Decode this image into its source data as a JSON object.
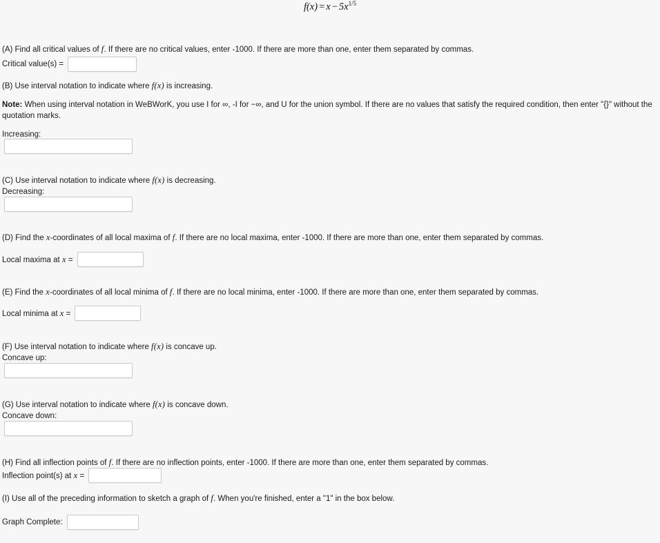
{
  "problem": {
    "formula": {
      "lhs": "f(x)",
      "equals": "=",
      "term1": "x",
      "minus": "−",
      "coefficient": "5",
      "variable": "x",
      "exponent": "1/5",
      "plain_text": "f(x) = x − 5x^(1/5)"
    }
  },
  "sections": {
    "a": {
      "prompt": "(A) Find all critical values of f. If there are no critical values, enter -1000. If there are more than one, enter them separated by commas.",
      "prompt_pre": "(A) Find all critical values of ",
      "prompt_math": "f",
      "prompt_post": ". If there are no critical values, enter -1000. If there are more than one, enter them separated by commas.",
      "field_label": "Critical value(s) =",
      "field_value": "",
      "field_placeholder": ""
    },
    "b": {
      "prompt_pre": "(B) Use interval notation to indicate where ",
      "prompt_math": "f(x)",
      "prompt_post": " is increasing.",
      "note_label": "Note:",
      "note_text_1": " When using interval notation in WeBWorK, you use I for ",
      "note_inf": "∞",
      "note_text_2": ", -I for ",
      "note_neg_inf": "−∞",
      "note_text_3": ", and U for the union symbol. If there are no values that satisfy the required condition, then enter \"{}\" without the quotation marks.",
      "field_label": "Increasing:",
      "field_value": "",
      "field_placeholder": ""
    },
    "c": {
      "prompt_pre": "(C) Use interval notation to indicate where ",
      "prompt_math": "f(x)",
      "prompt_post": " is decreasing.",
      "field_label": "Decreasing:",
      "field_value": "",
      "field_placeholder": ""
    },
    "d": {
      "prompt_pre": "(D) Find the ",
      "prompt_math": "x",
      "prompt_post": "-coordinates of all local maxima of ",
      "prompt_math2": "f",
      "prompt_post2": ". If there are no local maxima, enter -1000. If there are more than one, enter them separated by commas.",
      "field_label_pre": "Local maxima at ",
      "field_label_math": "x",
      "field_label_post": " =",
      "field_value": "",
      "field_placeholder": ""
    },
    "e": {
      "prompt_pre": "(E) Find the ",
      "prompt_math": "x",
      "prompt_post": "-coordinates of all local minima of ",
      "prompt_math2": "f",
      "prompt_post2": ". If there are no local minima, enter -1000. If there are more than one, enter them separated by commas.",
      "field_label_pre": "Local minima at ",
      "field_label_math": "x",
      "field_label_post": " =",
      "field_value": "",
      "field_placeholder": ""
    },
    "f": {
      "prompt_pre": "(F) Use interval notation to indicate where ",
      "prompt_math": "f(x)",
      "prompt_post": " is concave up.",
      "field_label": "Concave up:",
      "field_value": "",
      "field_placeholder": ""
    },
    "g": {
      "prompt_pre": "(G) Use interval notation to indicate where ",
      "prompt_math": "f(x)",
      "prompt_post": " is concave down.",
      "field_label": "Concave down:",
      "field_value": "",
      "field_placeholder": ""
    },
    "h": {
      "prompt_pre": "(H) Find all inflection points of ",
      "prompt_math": "f",
      "prompt_post": ". If there are no inflection points, enter -1000. If there are more than one, enter them separated by commas.",
      "field_label_pre": "Inflection point(s) at ",
      "field_label_math": "x",
      "field_label_post": " =",
      "field_value": "",
      "field_placeholder": ""
    },
    "i": {
      "prompt_pre": "(I) Use all of the preceding information to sketch a graph of ",
      "prompt_math": "f",
      "prompt_post": ". When you're finished, enter a \"1\" in the box below.",
      "field_label": "Graph Complete:",
      "field_value": "",
      "field_placeholder": ""
    }
  },
  "colors": {
    "background": "#f7f7f7",
    "text": "#1a1a1a",
    "input_border": "#c9c9c9",
    "input_background": "#ffffff"
  }
}
